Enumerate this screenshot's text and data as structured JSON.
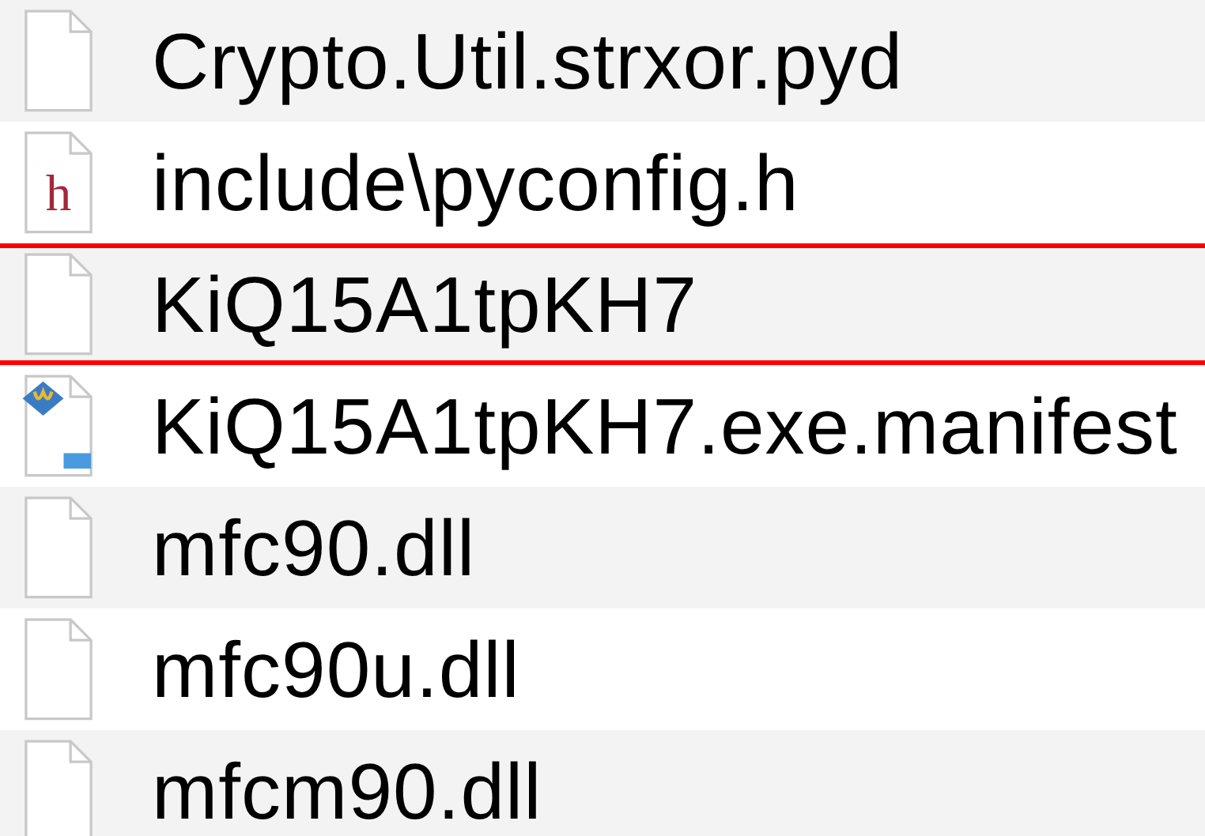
{
  "files": [
    {
      "name": "Crypto.Util.strxor.pyd",
      "kind": "document",
      "marked": false
    },
    {
      "name": "include\\pyconfig.h",
      "kind": "header",
      "icon_letter": "h",
      "marked": false
    },
    {
      "name": "KiQ15A1tpKH7",
      "kind": "document",
      "marked": true
    },
    {
      "name": "KiQ15A1tpKH7.exe.manifest",
      "kind": "text",
      "marked": false
    },
    {
      "name": "mfc90.dll",
      "kind": "document",
      "marked": false
    },
    {
      "name": "mfc90u.dll",
      "kind": "document",
      "marked": false
    },
    {
      "name": "mfcm90.dll",
      "kind": "document",
      "marked": false
    }
  ]
}
